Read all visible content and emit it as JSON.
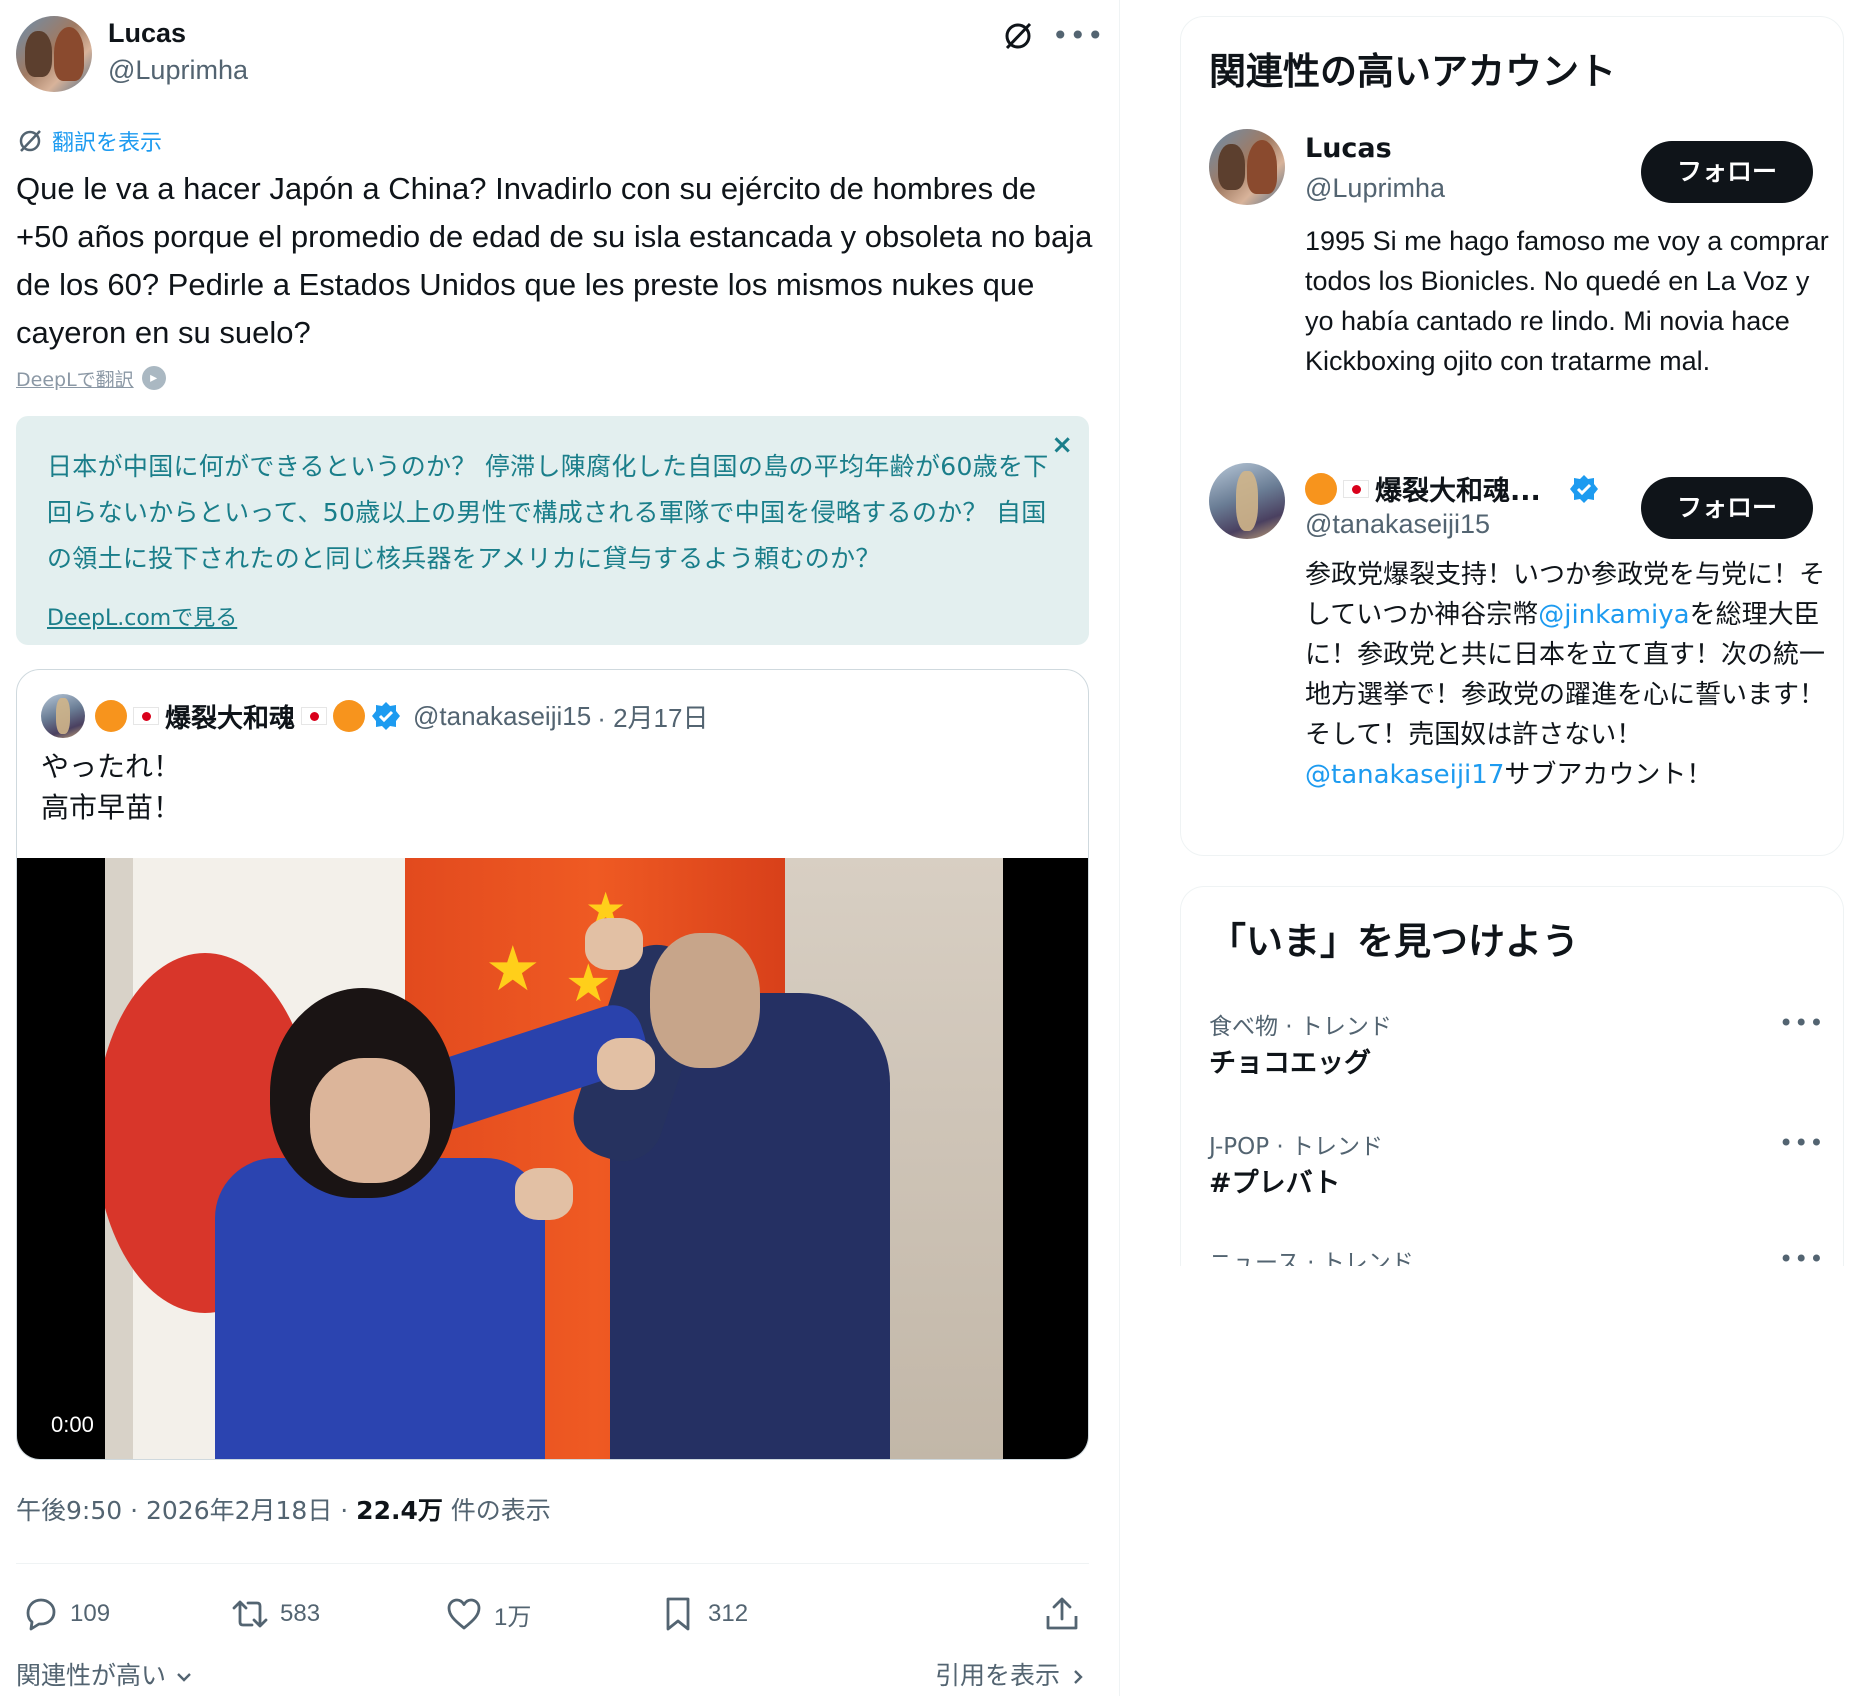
{
  "tweet": {
    "author": {
      "name": "Lucas",
      "handle": "@Luprimha"
    },
    "translate_label": "翻訳を表示",
    "text": "Que le va a hacer Japón a China? Invadirlo con su ejército de hombres de +50 años porque el promedio de edad de su isla estancada y obsoleta no baja de los 60? Pedirle a Estados Unidos que les preste los mismos nukes que cayeron en su suelo?",
    "deepl_label": "DeepLで翻訳",
    "translation": {
      "text": "日本が中国に何ができるというのか？ 停滞し陳腐化した自国の島の平均年齢が60歳を下回らないからといって、50歳以上の男性で構成される軍隊で中国を侵略するのか？ 自国の領土に投下されたのと同じ核兵器をアメリカに貸与するよう頼むのか？",
      "close_glyph": "×",
      "link": "DeepL.comで見る"
    },
    "quote": {
      "name": "爆裂大和魂",
      "handle": "@tanakaseiji15",
      "date": "· 2月17日",
      "line1": "やったれ！",
      "line2": "高市早苗！",
      "video_time": "0:00"
    },
    "meta": {
      "time": "午後9:50 · 2026年2月18日 · ",
      "views": "22.4万",
      "views_suffix": " 件の表示"
    },
    "actions": {
      "replies": "109",
      "reposts": "583",
      "likes": "1万",
      "bookmarks": "312"
    },
    "sort_label": "関連性が高い",
    "quotes_link": "引用を表示"
  },
  "sidebar": {
    "who_title": "関連性の高いアカウント",
    "follow_label": "フォロー",
    "accounts": [
      {
        "name": "Lucas",
        "handle": "@Luprimha",
        "bio": "1995 Si me hago famoso me voy a comprar todos los Bionicles. No quedé en La Voz y yo había cantado re lindo. Mi novia hace Kickboxing ojito con tratarme mal."
      },
      {
        "name": "爆裂大和魂...",
        "handle": "@tanakaseiji15",
        "bio_part1": "参政党爆裂支持！いつか参政党を与党に！そしていつか神谷宗幣",
        "bio_mention1": "@jinkamiya",
        "bio_part2": "を総理大臣に！参政党と共に日本を立て直す！次の統一地方選挙で！参政党の躍進を心に誓います！そして！売国奴は許さない！",
        "bio_mention2": "@tanakaseiji17",
        "bio_part3": "サブアカウント！"
      }
    ],
    "trends_title": "「いま」を見つけよう",
    "trends": [
      {
        "meta": "食べ物 · トレンド",
        "name": "チョコエッグ"
      },
      {
        "meta": "J-POP · トレンド",
        "name": "#プレバト"
      },
      {
        "meta": "ニュース · トレンド",
        "name": ""
      }
    ]
  },
  "colors": {
    "accent": "#1d9bf0",
    "translation_bg": "#e3efef",
    "translation_text": "#1a7e8a",
    "text": "#0f1419",
    "muted": "#536471"
  },
  "icons": [
    "grok-icon",
    "more-icon",
    "translate-icon",
    "deepl-icon",
    "close-icon",
    "verified-icon",
    "reply-icon",
    "repost-icon",
    "like-icon",
    "bookmark-icon",
    "share-icon",
    "chevron-down-icon",
    "chevron-right-icon"
  ]
}
